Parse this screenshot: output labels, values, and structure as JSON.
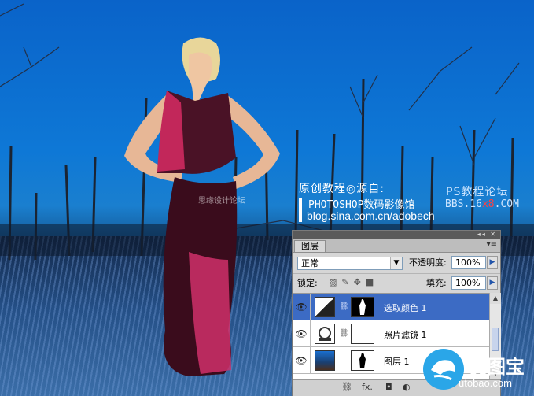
{
  "watermark": {
    "line1": "原创教程◎源自:",
    "line2": "PHOTOSHOP数码影像馆",
    "line3": "blog.sina.com.cn/adobech",
    "site_name": "PS教程论坛",
    "site_url_prefix": "BBS.16",
    "site_url_red": "x8",
    "site_url_suffix": ".COM",
    "faint_text": "思缘设计论坛"
  },
  "layers_panel": {
    "tab": "图层",
    "menu_icon": "panel-menu-icon",
    "blend_mode": "正常",
    "opacity_label": "不透明度:",
    "opacity_value": "100%",
    "lock_label": "锁定:",
    "fill_label": "填充:",
    "fill_value": "100%",
    "layers": [
      {
        "name": "选取颜色 1",
        "selected": true,
        "type": "adjustment"
      },
      {
        "name": "照片滤镜 1",
        "selected": false,
        "type": "adjustment"
      },
      {
        "name": "图层 1",
        "selected": false,
        "type": "image"
      }
    ],
    "footer_fx": "fx."
  },
  "logo": {
    "name": "优图宝",
    "url": "utobao.com",
    "color": "#2aa6e8"
  }
}
